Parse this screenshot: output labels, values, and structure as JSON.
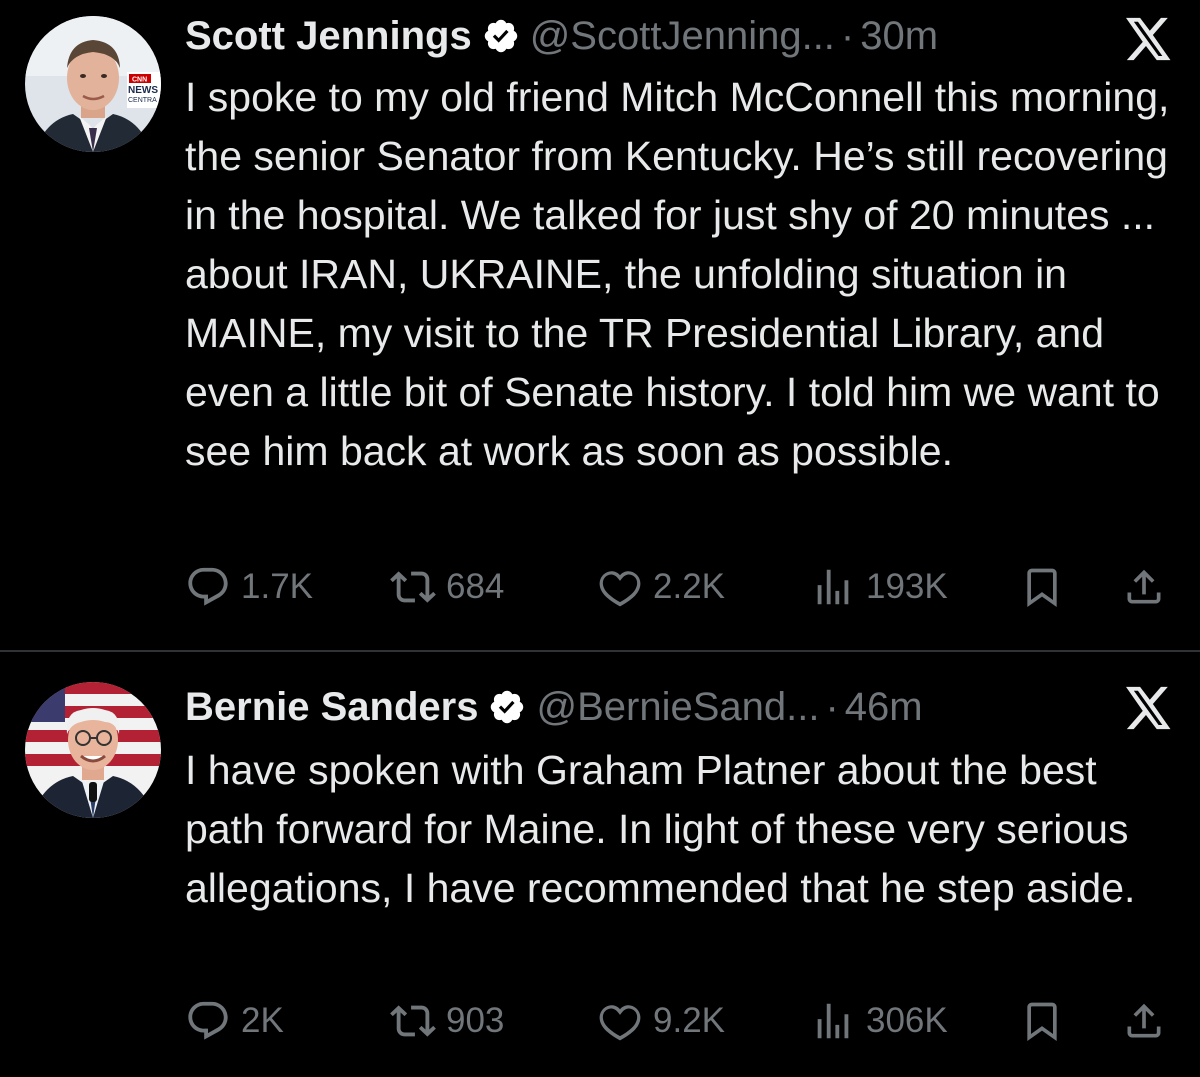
{
  "tweets": [
    {
      "name": "Scott Jennings",
      "handle": "@ScottJenning...",
      "separator": "·",
      "time": "30m",
      "avatar_badge_lines": [
        "CNN",
        "NEWS",
        "CENTRA"
      ],
      "text": "I spoke to my old friend Mitch McConnell this morning, the senior Senator from Kentucky. He’s still recovering in the hospital. We talked for just shy of 20 minutes ... about IRAN, UKRAINE, the unfolding situation in MAINE, my visit to the TR Presidential Library, and even a little bit of Senate history. I told him we want to see him back at work as soon as possible.",
      "replies": "1.7K",
      "reposts": "684",
      "likes": "2.2K",
      "views": "193K"
    },
    {
      "name": "Bernie Sanders",
      "handle": "@BernieSand...",
      "separator": "·",
      "time": "46m",
      "text": "I have spoken with Graham Platner about the best path forward for Maine. In light of these very serious allegations, I have recommended that he step aside.",
      "replies": "2K",
      "reposts": "903",
      "likes": "9.2K",
      "views": "306K"
    }
  ],
  "icons": {
    "verified": "verified-badge-icon",
    "x_logo": "x-logo-icon",
    "reply": "reply-icon",
    "repost": "repost-icon",
    "like": "heart-icon",
    "views": "views-icon",
    "bookmark": "bookmark-icon",
    "share": "share-icon"
  },
  "colors": {
    "background": "#000000",
    "text": "#e7e9ea",
    "muted": "#71767b",
    "divider": "#2f3336",
    "verified_badge": "#ffffff"
  }
}
